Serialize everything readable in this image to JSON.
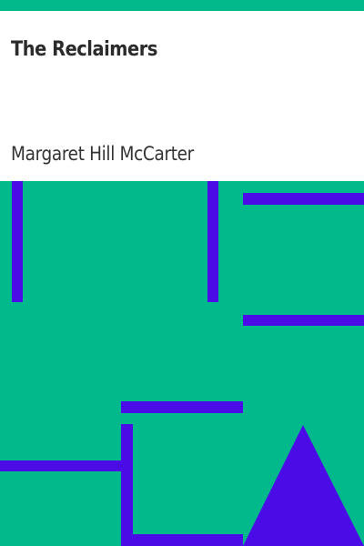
{
  "book": {
    "title": "The Reclaimers",
    "author": "Margaret Hill McCarter"
  },
  "colors": {
    "background": "#02b98b",
    "panel": "#ffffff",
    "pattern": "#4b0be6"
  },
  "decoration": {
    "pattern_icon": "geometric-bars-and-triangle-icon"
  }
}
